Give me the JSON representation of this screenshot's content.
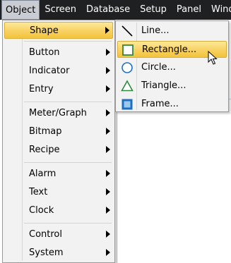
{
  "menubar": {
    "items": [
      {
        "label": "Object"
      },
      {
        "label": "Screen"
      },
      {
        "label": "Database"
      },
      {
        "label": "Setup"
      },
      {
        "label": "Panel"
      },
      {
        "label": "Wind"
      }
    ]
  },
  "object_menu": {
    "items": [
      {
        "label": "Shape",
        "icon": "shape-icon"
      },
      {
        "label": "Button"
      },
      {
        "label": "Indicator"
      },
      {
        "label": "Entry"
      },
      {
        "label": "Meter/Graph"
      },
      {
        "label": "Bitmap"
      },
      {
        "label": "Recipe"
      },
      {
        "label": "Alarm"
      },
      {
        "label": "Text"
      },
      {
        "label": "Clock"
      },
      {
        "label": "Control"
      },
      {
        "label": "System"
      }
    ]
  },
  "shape_submenu": {
    "items": [
      {
        "label": "Line...",
        "icon": "line-icon"
      },
      {
        "label": "Rectangle...",
        "icon": "rectangle-icon"
      },
      {
        "label": "Circle...",
        "icon": "circle-icon"
      },
      {
        "label": "Triangle...",
        "icon": "triangle-icon"
      },
      {
        "label": "Frame...",
        "icon": "frame-icon"
      }
    ]
  },
  "colors": {
    "menubar_bg": "#1f2021",
    "highlight": "#f8d162",
    "menu_bg": "#f2f2f2",
    "icon_green": "#2f8a3e",
    "icon_blue": "#1e6fc0"
  }
}
